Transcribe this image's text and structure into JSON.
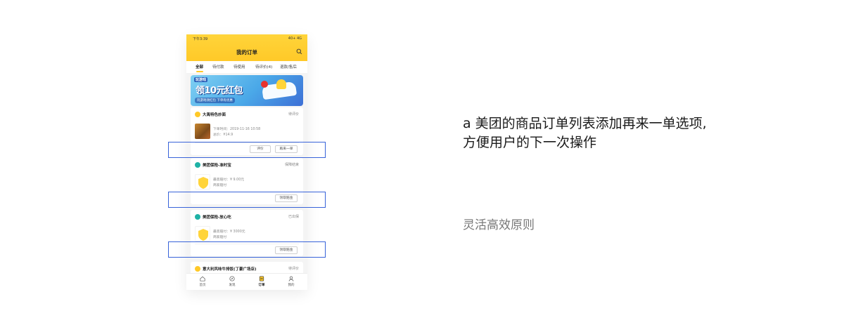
{
  "status_bar": {
    "time": "下午3:39",
    "right": "40+ 4G"
  },
  "header": {
    "title": "我的订单"
  },
  "tabs": [
    "全部",
    "待付款",
    "待使用",
    "待评价(4)",
    "退款/售后"
  ],
  "banner": {
    "top": "玩游戏",
    "main": "领10元红包",
    "sub": "玩游戏领红包 下单有优惠"
  },
  "orders": [
    {
      "shop": "大禹特色炒面",
      "status": "待评价",
      "time": "下单时间：2019-11-16 10:58",
      "total": "总价：¥14.9",
      "buttons": [
        "评价",
        "再来一单"
      ]
    },
    {
      "shop": "美团保险-准时宝",
      "status": "保障结束",
      "line1": "最高赔付：¥ 9.00元",
      "line2": "商家赔付",
      "buttons": [
        "领取赔金"
      ]
    },
    {
      "shop": "美团保险-放心吃",
      "status": "已出保",
      "line1": "最高赔付：¥ 3000元",
      "line2": "商家赔付",
      "buttons": [
        "领取赔金"
      ]
    },
    {
      "shop": "意大利风味牛排饭(丁豪广场店)",
      "status": "待评价"
    }
  ],
  "tabbar": [
    "首页",
    "发现",
    "订单",
    "我的"
  ],
  "colors": {
    "brand_yellow": "#ffc928",
    "highlight_blue": "#3863d9"
  },
  "annotation": {
    "title_line1": "a 美团的商品订单列表添加再来一单选项,",
    "title_line2": "方便用户的下一次操作",
    "subtitle": "灵活高效原则"
  }
}
